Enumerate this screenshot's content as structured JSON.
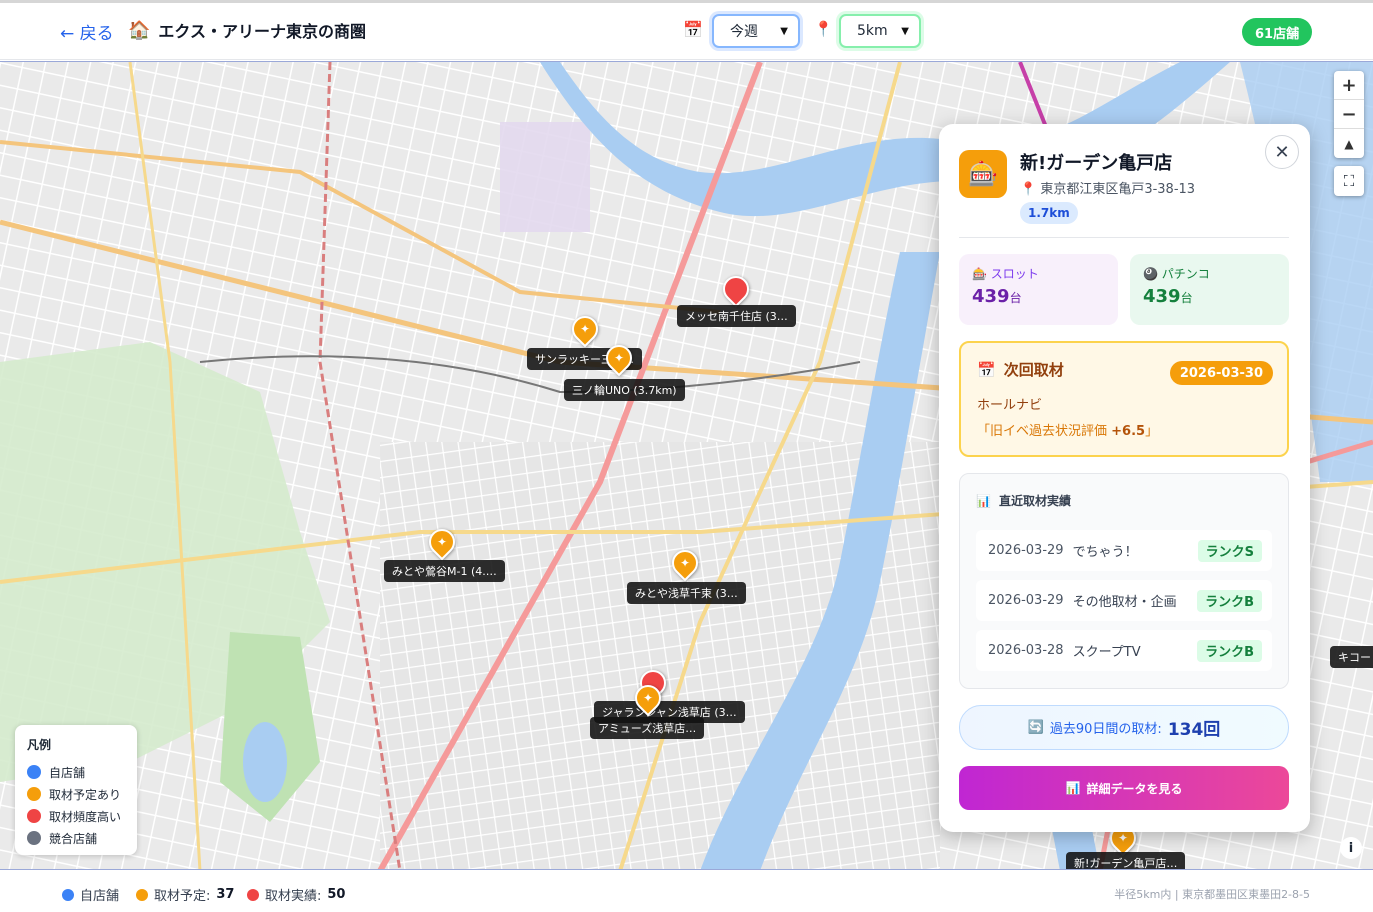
{
  "header": {
    "back_label": "← 戻る",
    "home_icon": "🏠",
    "title": "エクス・アリーナ東京の商圏",
    "period_icon": "📅",
    "period_value": "今週",
    "radius_icon": "📍",
    "radius_value": "5km",
    "store_count": "61店舗"
  },
  "map": {
    "zoom_in": "+",
    "zoom_out": "−",
    "compass": "▲",
    "markers": [
      {
        "type": "sched",
        "label": "サンラッキー三ノ…"
      },
      {
        "type": "sched",
        "label": "三ノ輪UNO (3.7km)"
      },
      {
        "type": "freq",
        "label": "メッセ南千住店 (3…"
      },
      {
        "type": "sched",
        "label": "みとや鶯谷M-1 (4.…"
      },
      {
        "type": "sched",
        "label": "みとや浅草千束 (3…"
      },
      {
        "type": "freq",
        "label": "ジャランジャン浅草店 (3…"
      },
      {
        "type": "sched",
        "label": "アミューズ浅草店…"
      },
      {
        "type": "sched",
        "label": "新!ガーデン亀戸店…"
      }
    ],
    "edge_label": "キコー"
  },
  "legend": {
    "title": "凡例",
    "items": [
      {
        "label": "自店舗",
        "color": "#3b82f6"
      },
      {
        "label": "取材予定あり",
        "color": "#f59e0b"
      },
      {
        "label": "取材頻度高い",
        "color": "#ef4444"
      },
      {
        "label": "競合店舗",
        "color": "#6b7280"
      }
    ]
  },
  "panel": {
    "store_name": "新!ガーデン亀戸店",
    "address": "東京都江東区亀戸3-38-13",
    "distance": "1.7km",
    "slot_label": "スロット",
    "slot_value": "439",
    "pachinko_label": "パチンコ",
    "pachinko_value": "439",
    "unit": "台",
    "next": {
      "title": "次回取材",
      "date": "2026-03-30",
      "media": "ホールナビ",
      "event_prefix": "「旧イベ過去状況評価 ",
      "event_score": "+6.5",
      "event_suffix": "」"
    },
    "recent": {
      "title": "直近取材実績",
      "rows": [
        {
          "date": "2026-03-29",
          "name": "でちゃう！",
          "rank": "ランクS"
        },
        {
          "date": "2026-03-29",
          "name": "その他取材・企画",
          "rank": "ランクB"
        },
        {
          "date": "2026-03-28",
          "name": "スクープTV",
          "rank": "ランクB"
        }
      ]
    },
    "summary_label": "過去90日間の取材:",
    "summary_value": "134回",
    "detail_button": "詳細データを見る"
  },
  "footer": {
    "own_label": "自店舗",
    "sched_label": "取材予定:",
    "sched_value": "37",
    "record_label": "取材実績:",
    "record_value": "50",
    "note": "半径5km内 | 東京都墨田区東墨田2-8-5"
  },
  "colors": {
    "accent": "#2563eb",
    "scheduled": "#f59e0b",
    "frequent": "#ef4444",
    "competitor": "#6b7280",
    "river": "#a9cdf2",
    "park": "#c9e8c0"
  }
}
